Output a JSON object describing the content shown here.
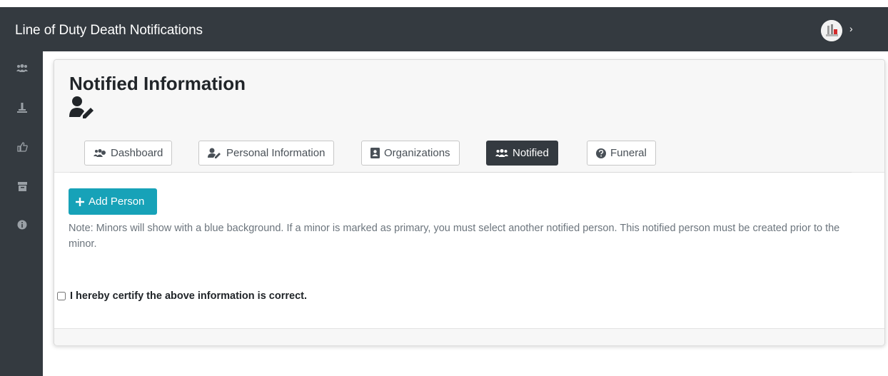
{
  "app": {
    "title": "Line of Duty Death Notifications",
    "chevron": "›"
  },
  "sidebar": {
    "items": [
      {
        "icon": "users-cog-icon"
      },
      {
        "icon": "monument-icon"
      },
      {
        "icon": "thumbs-up-icon"
      },
      {
        "icon": "archive-icon"
      },
      {
        "icon": "info-circle-icon"
      }
    ]
  },
  "page": {
    "title": "Notified Information",
    "title_icon": "user-edit-icon"
  },
  "tabs": [
    {
      "label": "Dashboard",
      "icon": "users-cog-icon",
      "active": false
    },
    {
      "label": "Personal Information",
      "icon": "user-edit-icon",
      "active": false
    },
    {
      "label": "Organizations",
      "icon": "address-book-icon",
      "active": false
    },
    {
      "label": "Notified",
      "icon": "users-icon",
      "active": true
    },
    {
      "label": "Funeral",
      "icon": "question-circle-icon",
      "active": false
    }
  ],
  "actions": {
    "add_person_label": "Add Person"
  },
  "note": "Note: Minors will show with a blue background. If a minor is marked as primary, you must select another notified person. This notified person must be created prior to the minor.",
  "certify": {
    "label": "I hereby certify the above information is correct.",
    "checked": false
  },
  "colors": {
    "topbar": "#343a40",
    "accent": "#17a2b8",
    "active_tab": "#343a40"
  }
}
